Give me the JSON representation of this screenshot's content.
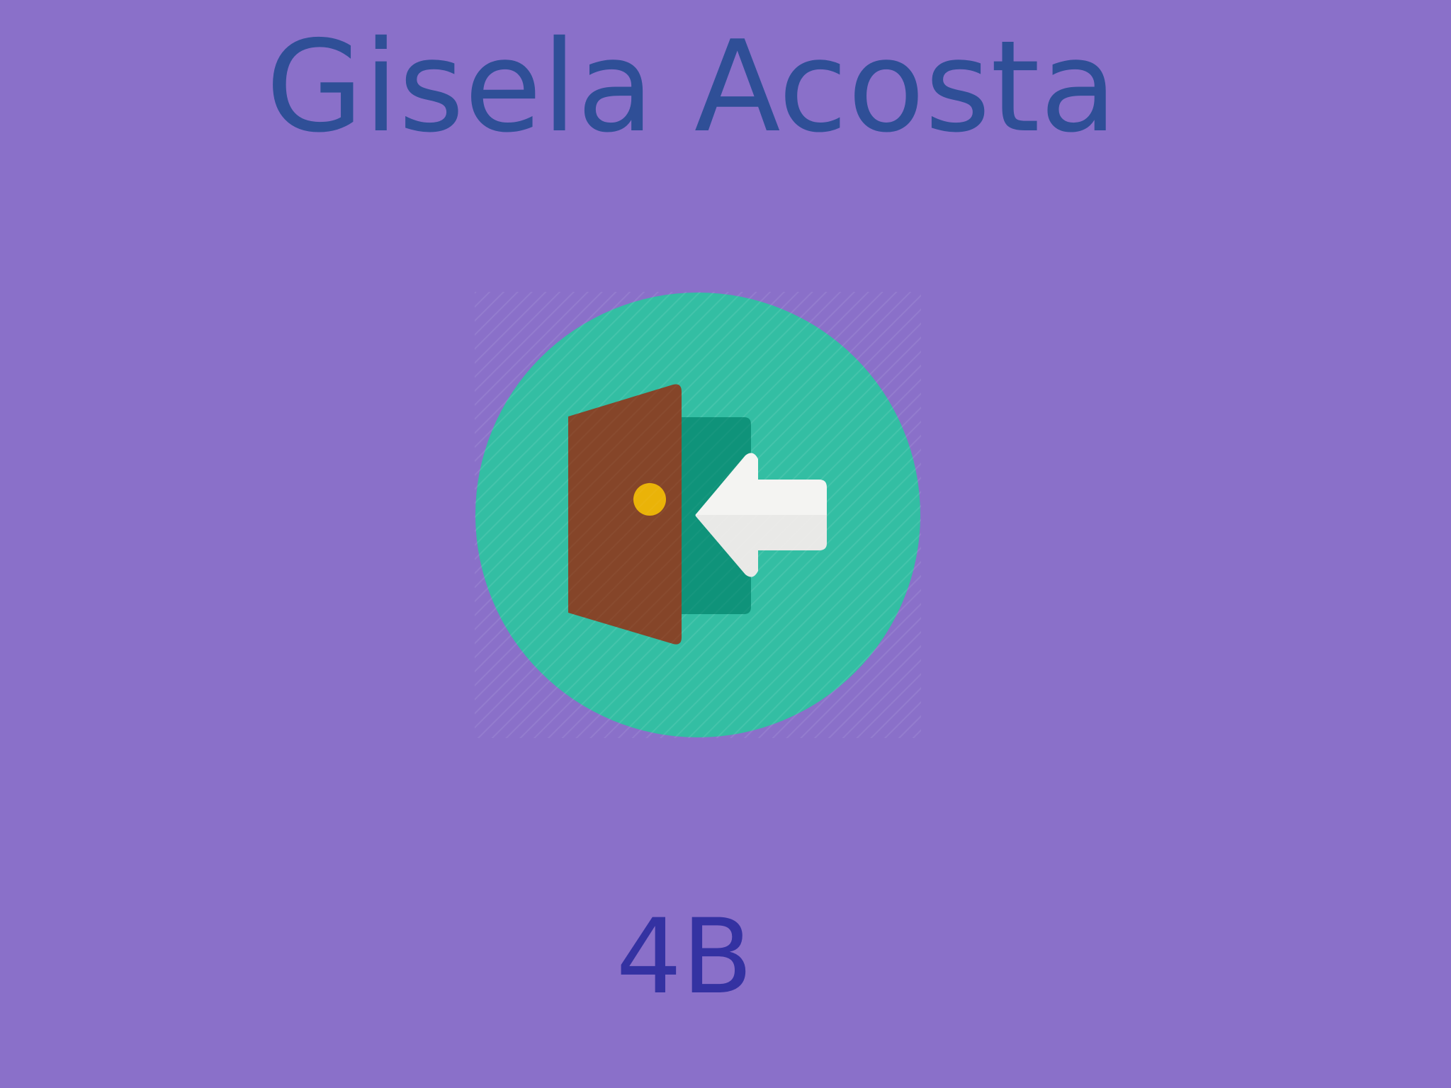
{
  "profile": {
    "name": "Gisela Acosta",
    "room": "4B"
  },
  "actions": {
    "login_icon": "enter-door-icon"
  },
  "colors": {
    "background": "#8a70c9",
    "name_text": "#2f4f97",
    "room_text": "#3432a2",
    "icon_circle": "#33bea3",
    "door": "#854529",
    "door_frame": "#0f937a",
    "door_knob": "#eab308",
    "arrow": "#f4f4f2"
  }
}
